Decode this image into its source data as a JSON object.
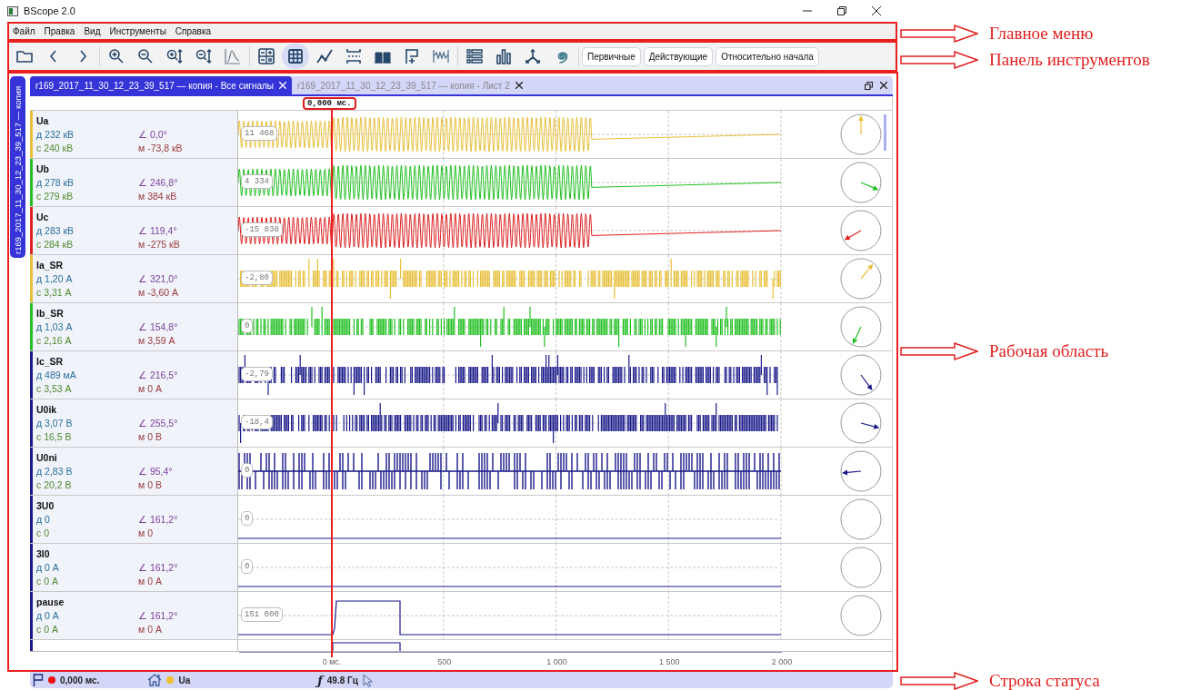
{
  "window": {
    "title": "BScope 2.0"
  },
  "menu": [
    {
      "label": "Файл"
    },
    {
      "label": "Правка"
    },
    {
      "label": "Вид"
    },
    {
      "label": "Инструменты"
    },
    {
      "label": "Справка"
    }
  ],
  "toolbar": {
    "groups": [
      [
        {
          "kind": "folder",
          "selected": false
        },
        {
          "kind": "back",
          "selected": false
        },
        {
          "kind": "forward",
          "selected": false
        }
      ],
      [
        {
          "kind": "zoom_in",
          "selected": false
        },
        {
          "kind": "zoom_out",
          "selected": false
        },
        {
          "kind": "zoom_in_v",
          "selected": false
        },
        {
          "kind": "zoom_out_v",
          "selected": false
        },
        {
          "kind": "spectrum",
          "selected": false
        }
      ],
      [
        {
          "kind": "calculator",
          "selected": false
        },
        {
          "kind": "grid",
          "selected": true
        },
        {
          "kind": "polyline",
          "selected": false
        },
        {
          "kind": "cursors",
          "selected": false
        },
        {
          "kind": "blocks",
          "selected": false
        },
        {
          "kind": "marker",
          "selected": false
        },
        {
          "kind": "wave",
          "selected": false
        }
      ],
      [
        {
          "kind": "list",
          "selected": false
        },
        {
          "kind": "barchart",
          "selected": false
        },
        {
          "kind": "axes",
          "selected": false
        },
        {
          "kind": "spiral",
          "selected": false
        }
      ]
    ],
    "buttons": [
      {
        "label": "Первичные"
      },
      {
        "label": "Действующие"
      },
      {
        "label": "Относительно начала"
      }
    ]
  },
  "side_tab": {
    "label": "r169_2017_11_30_12_23_39_517 — копия"
  },
  "tabs": [
    {
      "label": "r169_2017_11_30_12_23_39_517 — копия - Все сигналы",
      "selected": true
    },
    {
      "label": "r169_2017_11_30_12_23_39_517 — копия - Лист 2",
      "selected": false
    }
  ],
  "cursor": {
    "label": "0,000 мс."
  },
  "channels": [
    {
      "name": "Ua",
      "rms": "д 232 кВ",
      "angle": "∠ 0,0°",
      "avg": "с 240 кВ",
      "inst": "м -73,8 кВ",
      "color": "#e8c03a",
      "kind": "sine",
      "badge": "11 468"
    },
    {
      "name": "Ub",
      "rms": "д 278 кВ",
      "angle": "∠ 246,8°",
      "avg": "с 279 кВ",
      "inst": "м 384 кВ",
      "color": "#22c022",
      "kind": "sine",
      "badge": "4 334"
    },
    {
      "name": "Uc",
      "rms": "д 283 кВ",
      "angle": "∠ 119,4°",
      "avg": "с 284 кВ",
      "inst": "м -275 кВ",
      "color": "#dd2222",
      "kind": "sine",
      "badge": "-15 838"
    },
    {
      "name": "Ia_SR",
      "rms": "д 1,20 А",
      "angle": "∠ 321,0°",
      "avg": "с 3,31 А",
      "inst": "м -3,60 А",
      "color": "#e8c03a",
      "kind": "pulse",
      "badge": "-2,80"
    },
    {
      "name": "Ib_SR",
      "rms": "д 1,03 А",
      "angle": "∠ 154,8°",
      "avg": "с 2,16 А",
      "inst": "м 3,59 А",
      "color": "#22c022",
      "kind": "pulse",
      "badge": "0"
    },
    {
      "name": "Ic_SR",
      "rms": "д 489 мА",
      "angle": "∠ 216,5°",
      "avg": "с 3,53 А",
      "inst": "м 0 А",
      "color": "#1a1a8a",
      "kind": "pulse",
      "badge": "-2,79"
    },
    {
      "name": "U0ik",
      "rms": "д 3,07 В",
      "angle": "∠ 255,5°",
      "avg": "с 16,5 В",
      "inst": "м 0 В",
      "color": "#1a1a8a",
      "kind": "pulse",
      "badge": "-18,4"
    },
    {
      "name": "U0ni",
      "rms": "д 2,83 В",
      "angle": "∠ 95,4°",
      "avg": "с 20,2 В",
      "inst": "м 0 В",
      "color": "#1a1a8a",
      "kind": "binary",
      "badge": "0"
    },
    {
      "name": "3U0",
      "rms": "д 0",
      "angle": "∠ 161,2°",
      "avg": "с 0",
      "inst": "м 0",
      "color": "#1a1a8a",
      "kind": "flat",
      "badge": "0"
    },
    {
      "name": "3I0",
      "rms": "д 0 А",
      "angle": "∠ 161,2°",
      "avg": "с 0 А",
      "inst": "м 0 А",
      "color": "#1a1a8a",
      "kind": "flat",
      "badge": "0"
    },
    {
      "name": "pause",
      "rms": "д 0 А",
      "angle": "∠ 161,2°",
      "avg": "с 0 А",
      "inst": "м 0 А",
      "color": "#1a1a8a",
      "kind": "step",
      "badge": "151 000"
    }
  ],
  "partial_channel": {
    "color": "#1a1a8a"
  },
  "time_axis": {
    "ticks": [
      {
        "label": "0 мс."
      },
      {
        "label": "500"
      },
      {
        "label": "1 000"
      },
      {
        "label": "1 500"
      },
      {
        "label": "2 000"
      }
    ]
  },
  "status_bar": {
    "cursor_marker": {
      "color": "#ee1111"
    },
    "cursor_time": "0,000 мс.",
    "channel_marker": {
      "color": "#f0c030"
    },
    "channel": "Ua",
    "freq_symbol": "ƒ",
    "frequency": "49.8 Гц"
  },
  "annotations": [
    {
      "label": "Главное меню"
    },
    {
      "label": "Панель инструментов"
    },
    {
      "label": "Рабочая область"
    },
    {
      "label": "Строка статуса"
    }
  ]
}
